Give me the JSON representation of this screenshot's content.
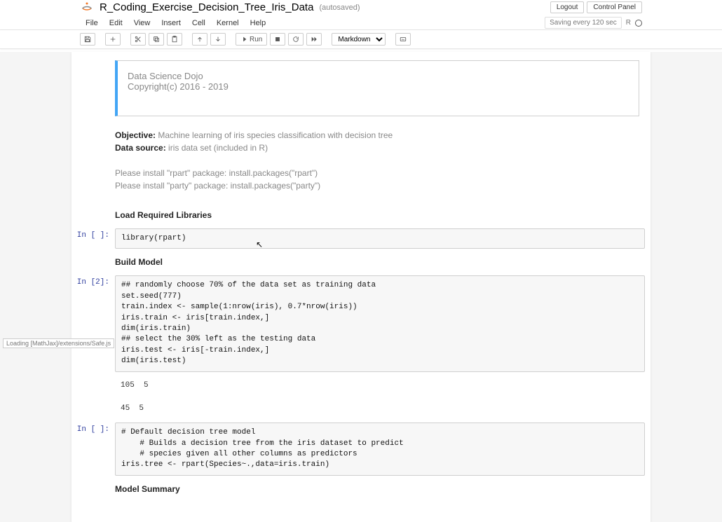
{
  "header": {
    "notebook_name": "R_Coding_Exercise_Decision_Tree_Iris_Data",
    "autosave": "(autosaved)",
    "logout": "Logout",
    "control_panel": "Control Panel"
  },
  "menubar": {
    "items": [
      "File",
      "Edit",
      "View",
      "Insert",
      "Cell",
      "Kernel",
      "Help"
    ],
    "save_status": "Saving every 120 sec",
    "kernel_name": "R"
  },
  "toolbar": {
    "run_label": "Run",
    "cell_type": "Markdown"
  },
  "cells": {
    "intro_md": {
      "line1": "Data Science Dojo",
      "line2": "Copyright(c) 2016 - 2019"
    },
    "objective_md": {
      "obj_label": "Objective:",
      "obj_text": " Machine learning of iris species classification with decision tree",
      "data_label": "Data source:",
      "data_text": " iris data set (included in R)",
      "pkg1": "Please install \"rpart\" package: install.packages(\"rpart\")",
      "pkg2": "Please install \"party\" package: install.packages(\"party\")"
    },
    "load_lib_header": "Load Required Libraries",
    "code1": {
      "prompt": "In [ ]:",
      "source": "library(rpart)"
    },
    "build_header": "Build Model",
    "code2": {
      "prompt": "In [2]:",
      "source": "## randomly choose 70% of the data set as training data\nset.seed(777)\ntrain.index <- sample(1:nrow(iris), 0.7*nrow(iris))\niris.train <- iris[train.index,]\ndim(iris.train)\n## select the 30% left as the testing data\niris.test <- iris[-train.index,]\ndim(iris.test)",
      "out1": "105  5",
      "out2": "45  5"
    },
    "code3": {
      "prompt": "In [ ]:",
      "source": "# Default decision tree model\n    # Builds a decision tree from the iris dataset to predict\n    # species given all other columns as predictors\niris.tree <- rpart(Species~.,data=iris.train)"
    },
    "summary_header": "Model Summary"
  },
  "status": {
    "mathjax": "Loading [MathJax]/extensions/Safe.js"
  }
}
